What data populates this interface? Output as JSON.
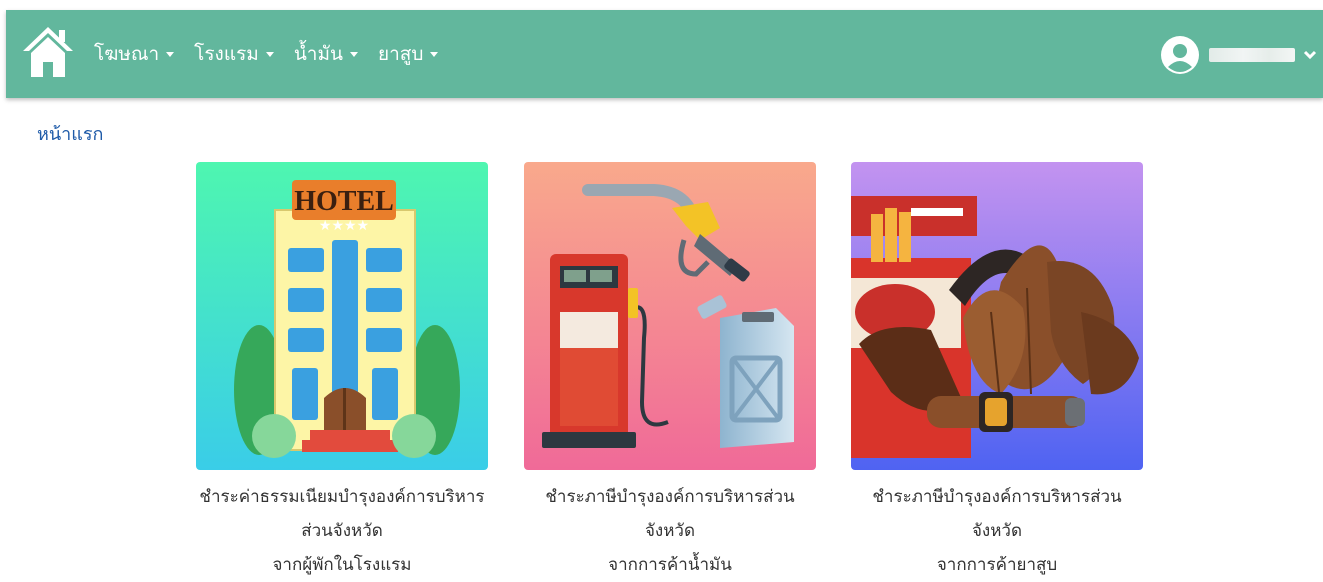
{
  "nav": {
    "menu": [
      {
        "label": "โฆษณา"
      },
      {
        "label": "โรงแรม"
      },
      {
        "label": "น้ำมัน"
      },
      {
        "label": "ยาสูบ"
      }
    ],
    "user": {
      "name_redacted": true
    }
  },
  "breadcrumb": {
    "home": "หน้าแรก"
  },
  "cards": [
    {
      "sign": "HOTEL",
      "stars": "★★★★",
      "lines": [
        "ชำระค่าธรรมเนียมบำรุงองค์การบริหาร",
        "ส่วนจังหวัด",
        "จากผู้พักในโรงแรม"
      ]
    },
    {
      "lines": [
        "ชำระภาษีบำรุงองค์การบริหารส่วน",
        "จังหวัด",
        "จากการค้าน้ำมัน"
      ]
    },
    {
      "lines": [
        "ชำระภาษีบำรุงองค์การบริหารส่วน",
        "จังหวัด",
        "จากการค้ายาสูบ"
      ]
    }
  ],
  "colors": {
    "navbar": "#62b79d",
    "link": "#1e5aa8",
    "caption": "#333333"
  }
}
